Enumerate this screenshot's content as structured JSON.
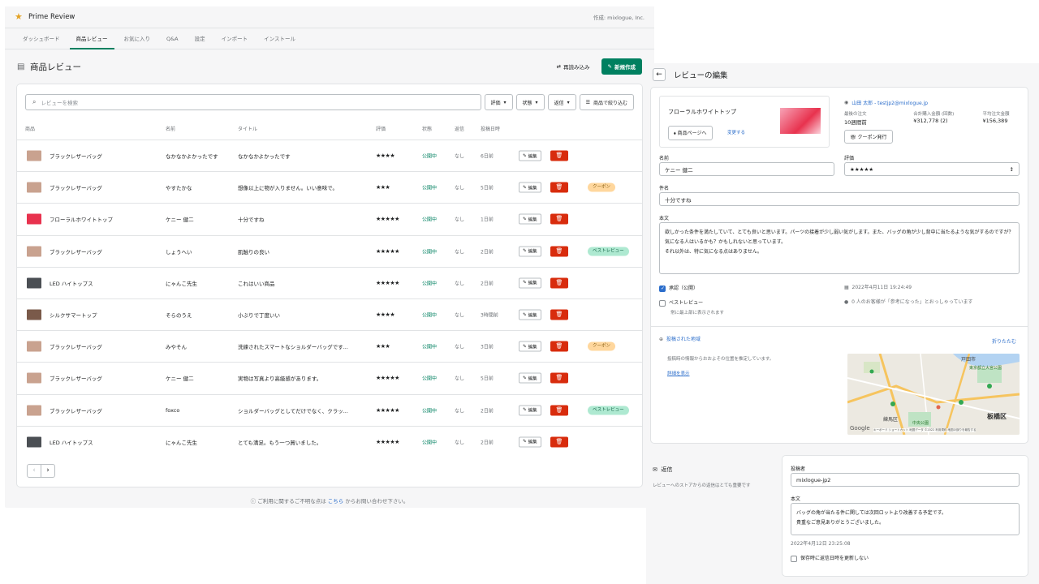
{
  "app": {
    "name": "Prime Review",
    "credit": "作成: mixlogue, Inc."
  },
  "tabs": [
    "ダッシュボード",
    "商品レビュー",
    "お気に入り",
    "Q&A",
    "設定",
    "インポート",
    "インストール"
  ],
  "page": {
    "title": "商品レビュー",
    "reload": "再読み込み",
    "new": "新規作成"
  },
  "filters": {
    "search_placeholder": "レビューを検索",
    "rating": "評価",
    "status": "状態",
    "reply": "返信",
    "product_filter": "商品で絞り込む"
  },
  "columns": {
    "product": "商品",
    "name": "名前",
    "title": "タイトル",
    "rating": "評価",
    "status": "状態",
    "reply": "返信",
    "date": "投稿日時"
  },
  "edit_label": "編集",
  "rows": [
    {
      "product": "ブラックレザーバッグ",
      "name": "なかなかよかったです",
      "title": "なかなかよかったです",
      "rating": "★★★★",
      "status": "公開中",
      "reply": "なし",
      "date": "6日前",
      "badge": "",
      "thumb": "#c9a28f"
    },
    {
      "product": "ブラックレザーバッグ",
      "name": "やすたかな",
      "title": "想像以上に物が入りません。いい意味で。",
      "rating": "★★★",
      "status": "公開中",
      "reply": "なし",
      "date": "5日前",
      "badge": "クーポン",
      "thumb": "#c9a28f"
    },
    {
      "product": "フローラルホワイトトップ",
      "name": "ケニー 健二",
      "title": "十分ですね",
      "rating": "★★★★★",
      "status": "公開中",
      "reply": "なし",
      "date": "1日前",
      "badge": "",
      "thumb": "#e8324e"
    },
    {
      "product": "ブラックレザーバッグ",
      "name": "しょうへい",
      "title": "肌触りの良い",
      "rating": "★★★★★",
      "status": "公開中",
      "reply": "なし",
      "date": "2日前",
      "badge": "ベストレビュー",
      "thumb": "#c9a28f"
    },
    {
      "product": "LED ハイトップス",
      "name": "にゃんこ先生",
      "title": "これはいい商品",
      "rating": "★★★★★",
      "status": "公開中",
      "reply": "なし",
      "date": "2日前",
      "badge": "",
      "thumb": "#4b4f54"
    },
    {
      "product": "シルクサマートップ",
      "name": "そらのうえ",
      "title": "小ぶりで丁度いい",
      "rating": "★★★★",
      "status": "公開中",
      "reply": "なし",
      "date": "3時間前",
      "badge": "",
      "thumb": "#7a5a4a"
    },
    {
      "product": "ブラックレザーバッグ",
      "name": "みやそん",
      "title": "洗練されたスマートなショルダーバッグです...",
      "rating": "★★★",
      "status": "公開中",
      "reply": "なし",
      "date": "3日前",
      "badge": "クーポン",
      "thumb": "#c9a28f"
    },
    {
      "product": "ブラックレザーバッグ",
      "name": "ケニー 健二",
      "title": "実物は写真より高級感があります。",
      "rating": "★★★★★",
      "status": "公開中",
      "reply": "なし",
      "date": "5日前",
      "badge": "",
      "thumb": "#c9a28f"
    },
    {
      "product": "ブラックレザーバッグ",
      "name": "foxco",
      "title": "ショルダーバッグとしてだけでなく、クラッ...",
      "rating": "★★★★★",
      "status": "公開中",
      "reply": "なし",
      "date": "2日前",
      "badge": "ベストレビュー",
      "thumb": "#c9a28f"
    },
    {
      "product": "LED ハイトップス",
      "name": "にゃんこ先生",
      "title": "とても満足。もう一つ買いました。",
      "rating": "★★★★★",
      "status": "公開中",
      "reply": "なし",
      "date": "2日前",
      "badge": "",
      "thumb": "#4b4f54"
    }
  ],
  "footer": {
    "pre": "ご利用に関するご不明な点は",
    "link": "こちら",
    "post": "からお問い合わせ下さい。"
  },
  "editor": {
    "title": "レビューの編集",
    "product_name": "フローラルホワイトトップ",
    "product_page": "商品ページへ",
    "change": "変更する",
    "customer": "山田 太郎 - testjp2@mixlogue.jp",
    "stats": [
      {
        "label": "最後の注文",
        "value": "10週間前"
      },
      {
        "label": "合計購入金額 (回数)",
        "value": "¥312,778 (2)"
      },
      {
        "label": "平均注文金額",
        "value": "¥156,389"
      }
    ],
    "coupon": "クーポン発行",
    "name_label": "名前",
    "name_value": "ケニー 健二",
    "rating_label": "評価",
    "rating_value": "★★★★★",
    "subject_label": "件名",
    "subject_value": "十分ですね",
    "body_label": "本文",
    "body_value": "欲しかった条件を満たしていて、とても良いと思います。パーツの接着が少し弱い気がします。また、バッグの角が少し背中に当たるような気がするのですが？気になる人はいるかも？かもしれないと思っています。\nそれ以外は、特に気になる点はありません。",
    "approved": "承認（公開）",
    "best": "ベストレビュー",
    "best_hint": "常に最上部に表示されます",
    "posted_at": "2022年4月11日 19:24:49",
    "helpful": "0 人のお客様が「参考になった」とおっしゃっています",
    "region_title": "投稿された地域",
    "collapse": "折りたたむ",
    "region_desc": "投稿時の情報からおおよその位置を推定しています。",
    "details": "詳細を表示",
    "map_labels": [
      "戸田市",
      "東京都立大宮公園",
      "板橋区",
      "練馬区",
      "中央公園",
      "Google",
      "キーボード ショートカット 地図データ ©2022 利用規約 地図の誤りを報告する"
    ]
  },
  "reply": {
    "section": "返信",
    "section_desc": "レビューへのストアからの返信はとても重要です",
    "author_label": "投稿者",
    "author_value": "mixlogue-jp2",
    "body_label": "本文",
    "body_value": "バッグの角が当たる件に関しては次回ロットより改善する予定です。\n貴重なご意見ありがとうございました。",
    "timestamp": "2022年4月12日 23:25:08",
    "keep_time": "保存時に返信日時を更新しない"
  }
}
